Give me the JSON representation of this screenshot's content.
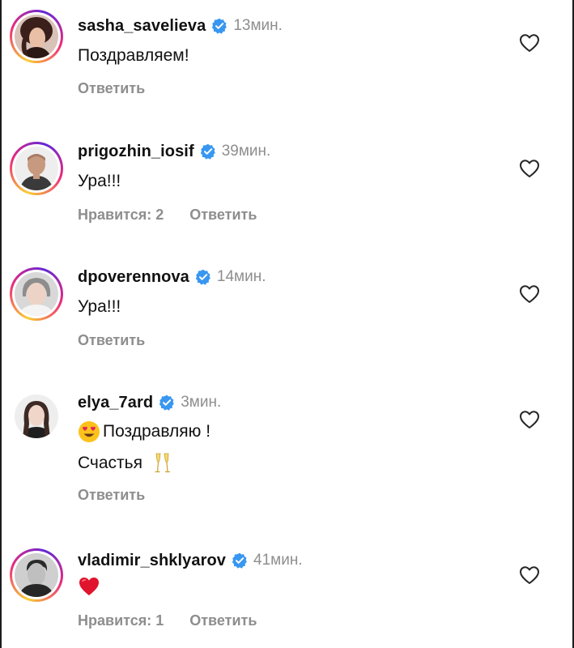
{
  "comments": [
    {
      "username": "sasha_savelieva",
      "time": "13мин.",
      "verified": true,
      "text": "Поздравляем!",
      "text_line2": "",
      "likes_label": "",
      "reply_label": "Ответить",
      "leading_emoji": "",
      "trailing_emoji": ""
    },
    {
      "username": "prigozhin_iosif",
      "time": "39мин.",
      "verified": true,
      "text": "Ура!!!",
      "text_line2": "",
      "likes_label": "Нравится: 2",
      "reply_label": "Ответить",
      "leading_emoji": "",
      "trailing_emoji": ""
    },
    {
      "username": "dpoverennova",
      "time": "14мин.",
      "verified": true,
      "text": "Ура!!!",
      "text_line2": "",
      "likes_label": "",
      "reply_label": "Ответить",
      "leading_emoji": "",
      "trailing_emoji": ""
    },
    {
      "username": "elya_7ard",
      "time": "3мин.",
      "verified": true,
      "text": "Поздравляю !",
      "text_line2": "Счастья",
      "likes_label": "",
      "reply_label": "Ответить",
      "leading_emoji": "heart-eyes-emoji",
      "trailing_emoji": "champagne-glasses-emoji"
    },
    {
      "username": "vladimir_shklyarov",
      "time": "41мин.",
      "verified": true,
      "text": "",
      "text_line2": "",
      "likes_label": "Нравится: 1",
      "reply_label": "Ответить",
      "leading_emoji": "red-heart-emoji",
      "trailing_emoji": ""
    }
  ],
  "colors": {
    "verified_blue": "#3897f0",
    "secondary_text": "#8e8e8e",
    "primary_text": "#111111",
    "story_ring": [
      "#f9ce34",
      "#ee2a7b",
      "#6228d7"
    ]
  },
  "icons": {
    "like": "heart-outline-icon",
    "verified": "verified-badge-icon"
  }
}
